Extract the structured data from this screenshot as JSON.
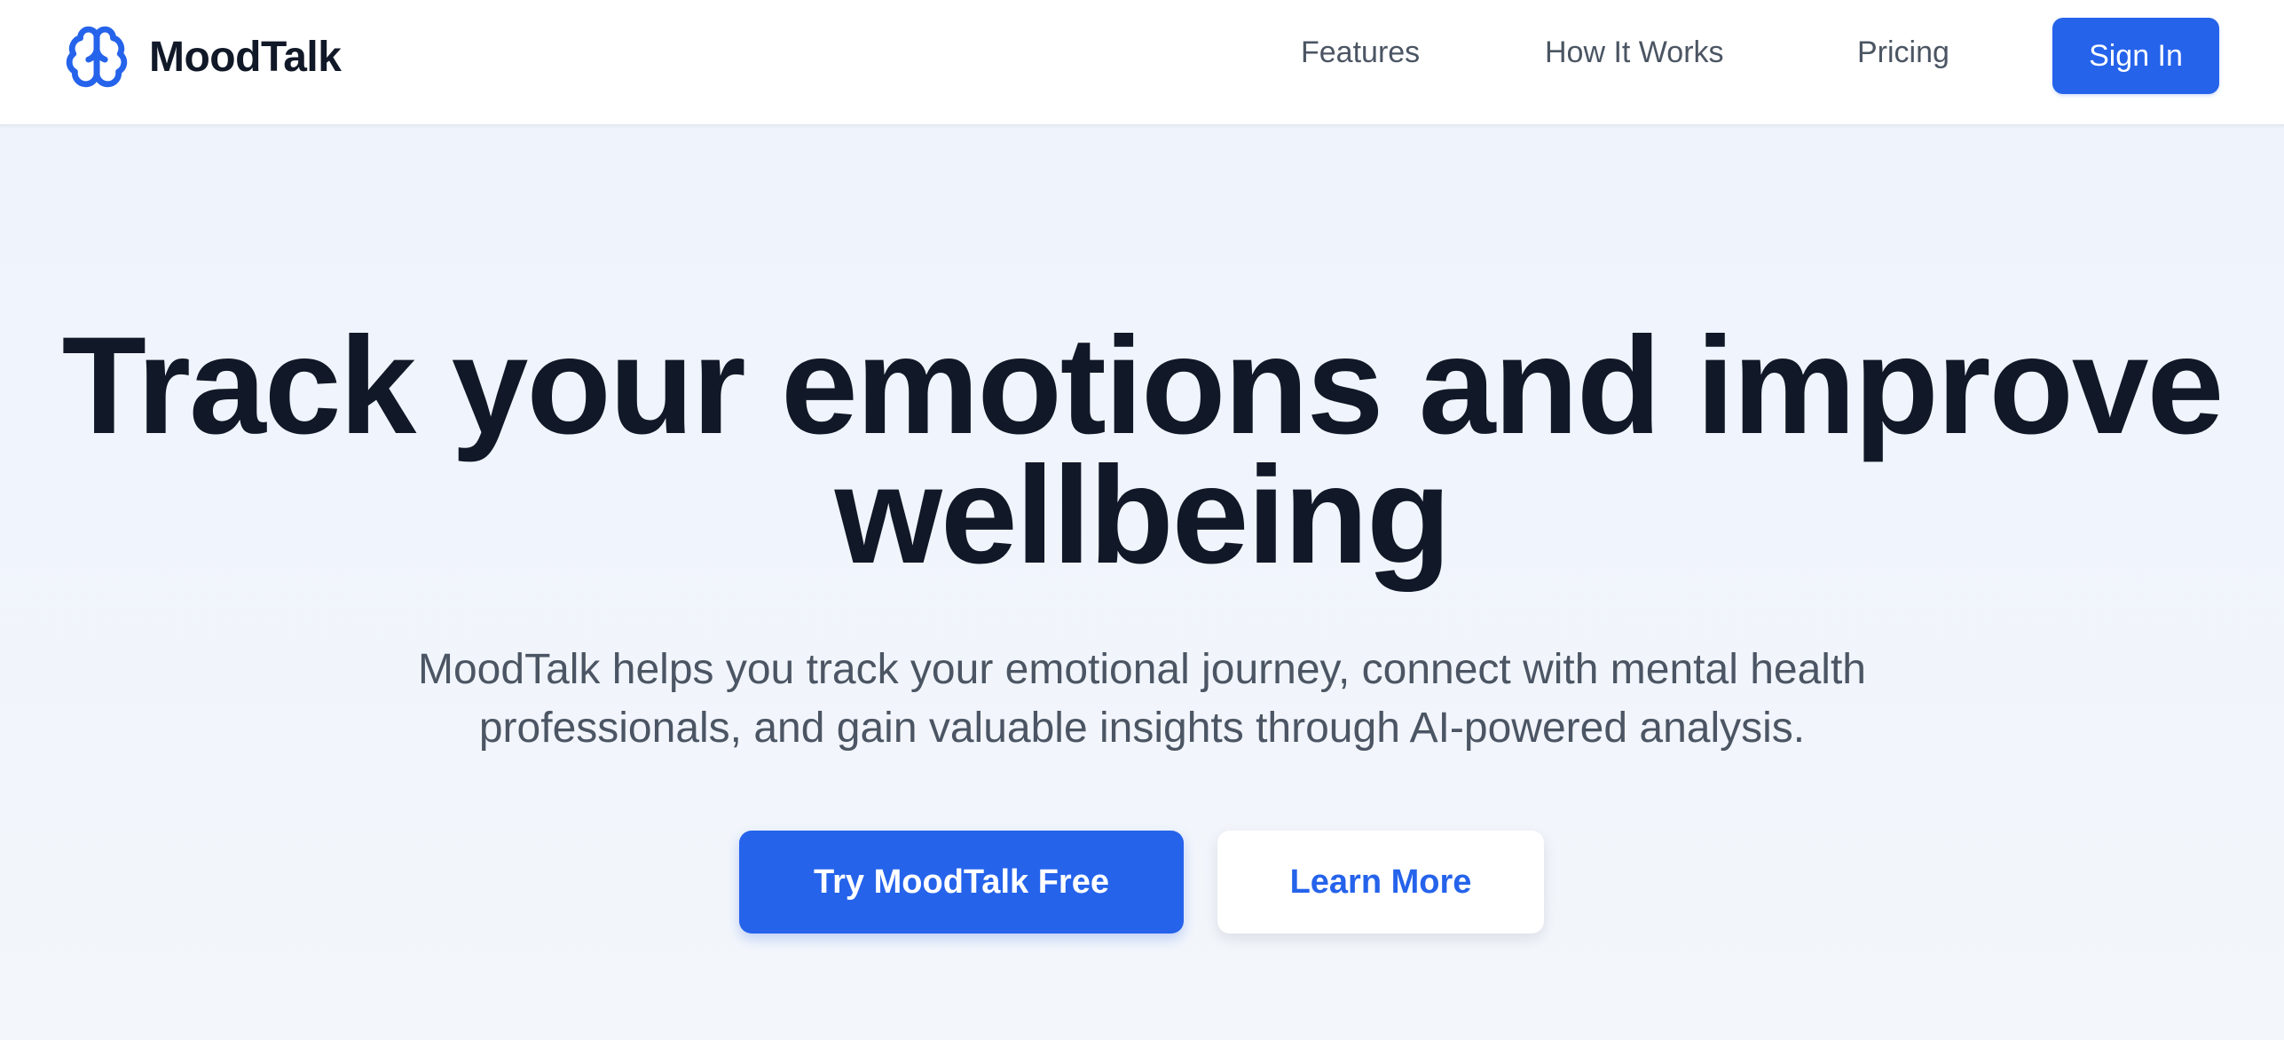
{
  "brand": {
    "name": "MoodTalk",
    "icon": "brain-icon",
    "color": "#2563eb"
  },
  "nav": {
    "links": [
      {
        "label": "Features"
      },
      {
        "label": "How It Works"
      },
      {
        "label": "Pricing"
      }
    ],
    "signin_label": "Sign In"
  },
  "hero": {
    "title_line1": "Track your emotions and improve",
    "title_line2": "wellbeing",
    "subtitle_line1": "MoodTalk helps you track your emotional journey, connect with mental health",
    "subtitle_line2": "professionals, and gain valuable insights through AI-powered analysis.",
    "primary_cta": "Try MoodTalk Free",
    "secondary_cta": "Learn More"
  },
  "colors": {
    "accent": "#2563eb",
    "heading": "#111827",
    "body_text": "#4b5563",
    "background": "#f1f5fc"
  }
}
